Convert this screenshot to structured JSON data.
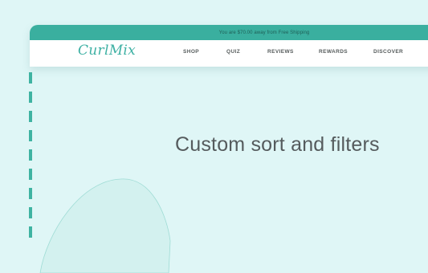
{
  "announcement": {
    "text": "You are $70.00 away from Free Shipping"
  },
  "brand": {
    "logo_text": "CurlMix"
  },
  "nav": {
    "shop": "SHOP",
    "quiz": "QUIZ",
    "reviews": "REVIEWS",
    "rewards": "REWARDS",
    "discover": "DISCOVER"
  },
  "headline": "Custom sort and filters",
  "colors": {
    "background": "#dff6f6",
    "accent": "#3aaf9f",
    "text": "#555b5d"
  }
}
